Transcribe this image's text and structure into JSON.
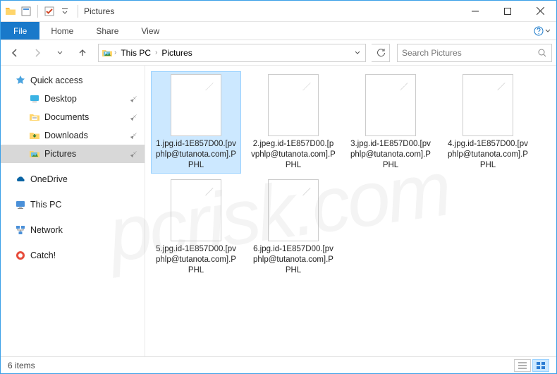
{
  "window": {
    "title": "Pictures"
  },
  "ribbon": {
    "file": "File",
    "tabs": [
      "Home",
      "Share",
      "View"
    ]
  },
  "breadcrumb": {
    "root": "This PC",
    "current": "Pictures"
  },
  "search": {
    "placeholder": "Search Pictures"
  },
  "sidebar": {
    "quick_access": "Quick access",
    "items": [
      {
        "label": "Desktop",
        "pinned": true
      },
      {
        "label": "Documents",
        "pinned": true
      },
      {
        "label": "Downloads",
        "pinned": true
      },
      {
        "label": "Pictures",
        "pinned": true,
        "selected": true
      }
    ],
    "onedrive": "OneDrive",
    "thispc": "This PC",
    "network": "Network",
    "catch": "Catch!"
  },
  "files": [
    {
      "name": "1.jpg.id-1E857D00.[pvphlp@tutanota.com].PPHL",
      "selected": true
    },
    {
      "name": "2.jpeg.id-1E857D00.[pvphlp@tutanota.com].PPHL"
    },
    {
      "name": "3.jpg.id-1E857D00.[pvphlp@tutanota.com].PPHL"
    },
    {
      "name": "4.jpg.id-1E857D00.[pvphlp@tutanota.com].PPHL"
    },
    {
      "name": "5.jpg.id-1E857D00.[pvphlp@tutanota.com].PPHL"
    },
    {
      "name": "6.jpg.id-1E857D00.[pvphlp@tutanota.com].PPHL"
    }
  ],
  "status": {
    "count": "6 items"
  }
}
